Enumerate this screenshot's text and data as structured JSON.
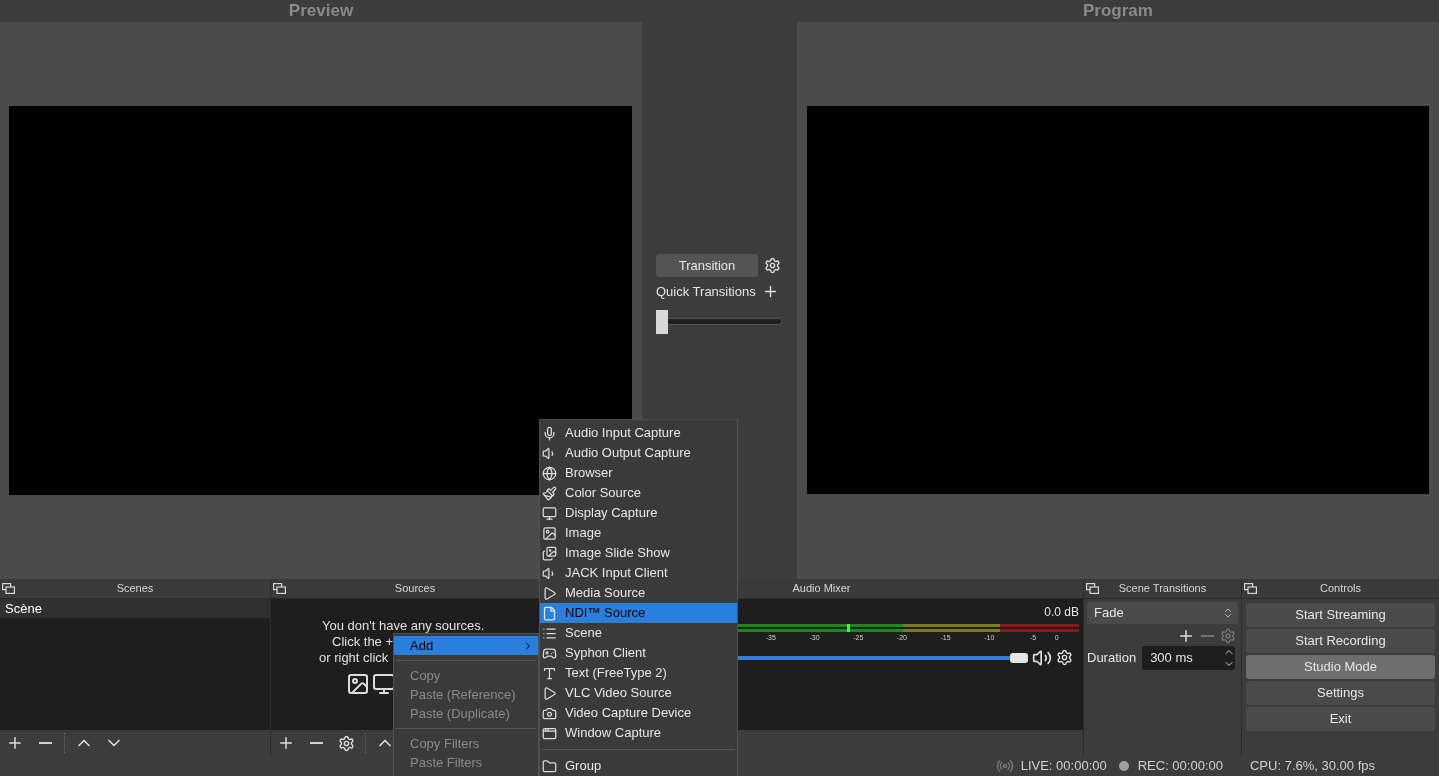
{
  "preview": {
    "title": "Preview"
  },
  "transition": {
    "button": "Transition",
    "quick_label": "Quick Transitions",
    "slider": {
      "level": 0
    }
  },
  "program": {
    "title": "Program"
  },
  "scenes": {
    "title": "Scenes",
    "items": [
      {
        "label": "Scène",
        "selected": true
      }
    ]
  },
  "sources": {
    "title": "Sources",
    "empty_lines": [
      "You don't have any sources.",
      "Click the +",
      "or right click"
    ]
  },
  "audio_mixer": {
    "title": "Audio Mixer",
    "reading": "0.0 dB",
    "scale": [
      "-35",
      "-30",
      "-25",
      "-20",
      "-15",
      "-10",
      "-5",
      "0"
    ],
    "volume": {
      "level": 1
    }
  },
  "scene_transitions": {
    "title": "Scene Transitions",
    "transition": "Fade",
    "duration_label": "Duration",
    "duration": "300 ms"
  },
  "controls": {
    "title": "Controls",
    "buttons": [
      {
        "label": "Start Streaming",
        "active": false
      },
      {
        "label": "Start Recording",
        "active": false
      },
      {
        "label": "Studio Mode",
        "active": true
      },
      {
        "label": "Settings",
        "active": false
      },
      {
        "label": "Exit",
        "active": false
      }
    ]
  },
  "context_menu": {
    "items": [
      {
        "kind": "submenu",
        "label": "Add",
        "selected": true,
        "disabled": false
      },
      {
        "kind": "separator"
      },
      {
        "kind": "item",
        "label": "Copy",
        "selected": false,
        "disabled": true
      },
      {
        "kind": "item",
        "label": "Paste (Reference)",
        "selected": false,
        "disabled": true
      },
      {
        "kind": "item",
        "label": "Paste (Duplicate)",
        "selected": false,
        "disabled": true
      },
      {
        "kind": "separator"
      },
      {
        "kind": "item",
        "label": "Copy Filters",
        "selected": false,
        "disabled": true
      },
      {
        "kind": "item",
        "label": "Paste Filters",
        "selected": false,
        "disabled": true
      }
    ]
  },
  "add_submenu": {
    "items": [
      {
        "kind": "item",
        "label": "Audio Input Capture",
        "selected": false
      },
      {
        "kind": "item",
        "label": "Audio Output Capture",
        "selected": false
      },
      {
        "kind": "item",
        "label": "Browser",
        "selected": false
      },
      {
        "kind": "item",
        "label": "Color Source",
        "selected": false
      },
      {
        "kind": "item",
        "label": "Display Capture",
        "selected": false
      },
      {
        "kind": "item",
        "label": "Image",
        "selected": false
      },
      {
        "kind": "item",
        "label": "Image Slide Show",
        "selected": false
      },
      {
        "kind": "item",
        "label": "JACK Input Client",
        "selected": false
      },
      {
        "kind": "item",
        "label": "Media Source",
        "selected": false
      },
      {
        "kind": "item",
        "label": "NDI™ Source",
        "selected": true
      },
      {
        "kind": "item",
        "label": "Scene",
        "selected": false
      },
      {
        "kind": "item",
        "label": "Syphon Client",
        "selected": false
      },
      {
        "kind": "item",
        "label": "Text (FreeType 2)",
        "selected": false
      },
      {
        "kind": "item",
        "label": "VLC Video Source",
        "selected": false
      },
      {
        "kind": "item",
        "label": "Video Capture Device",
        "selected": false
      },
      {
        "kind": "item",
        "label": "Window Capture",
        "selected": false
      },
      {
        "kind": "separator"
      },
      {
        "kind": "item",
        "label": "Group",
        "selected": false
      }
    ]
  },
  "status_bar": {
    "live": "LIVE: 00:00:00",
    "rec": "REC: 00:00:00",
    "cpu": "CPU: 7.6%, 30.00 fps"
  }
}
